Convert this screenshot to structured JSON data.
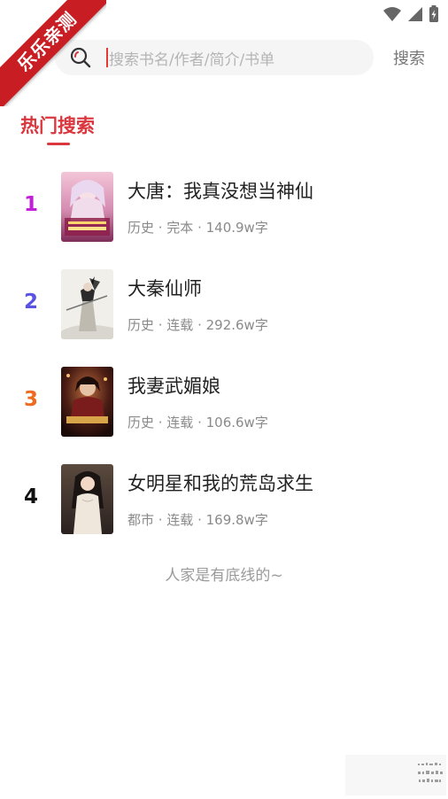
{
  "ribbon": {
    "label": "乐乐亲测"
  },
  "search": {
    "placeholder": "搜索书名/作者/简介/书单",
    "button_label": "搜索"
  },
  "section": {
    "title": "热门搜索"
  },
  "books": [
    {
      "rank": "1",
      "rank_color": "#c21fd9",
      "title": "大唐：我真没想当神仙",
      "meta": "历史 · 完本 · 140.9w字"
    },
    {
      "rank": "2",
      "rank_color": "#5a52e0",
      "title": "大秦仙师",
      "meta": "历史 · 连载 · 292.6w字"
    },
    {
      "rank": "3",
      "rank_color": "#ee6a1e",
      "title": "我妻武媚娘",
      "meta": "历史 · 连载 · 106.6w字"
    },
    {
      "rank": "4",
      "rank_color": "#111111",
      "title": "女明星和我的荒岛求生",
      "meta": "都市 · 连载 · 169.8w字"
    }
  ],
  "footer": {
    "note": "人家是有底线的~"
  },
  "colors": {
    "accent": "#d9363e",
    "ribbon": "#c81e23"
  },
  "icons": {
    "back": "back-arrow-icon",
    "search": "search-icon",
    "wifi": "wifi-icon",
    "signal": "signal-icon",
    "battery": "battery-icon"
  }
}
